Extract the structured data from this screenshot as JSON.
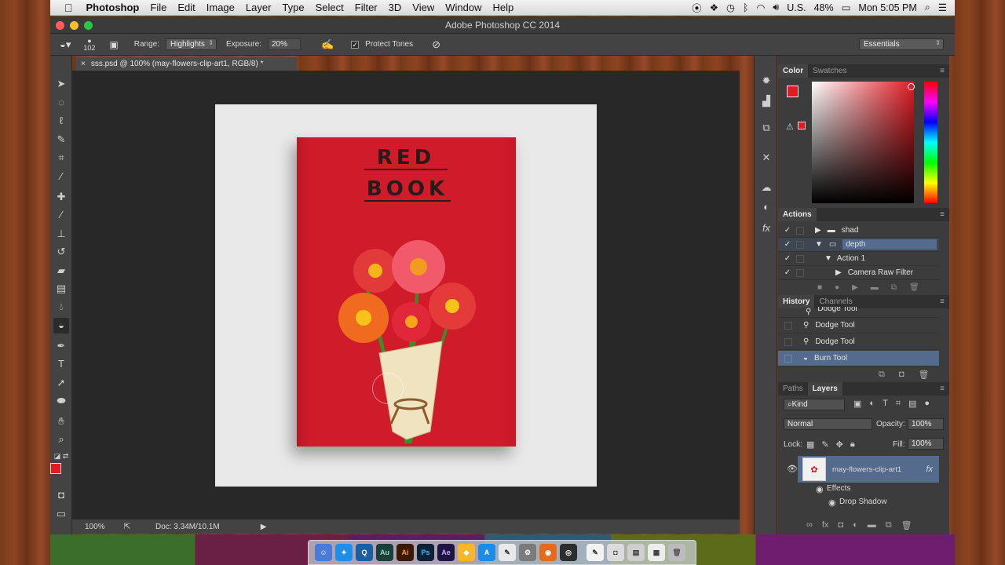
{
  "menubar": {
    "app": "Photoshop",
    "items": [
      "File",
      "Edit",
      "Image",
      "Layer",
      "Type",
      "Select",
      "Filter",
      "3D",
      "View",
      "Window",
      "Help"
    ],
    "input_source": "U.S.",
    "battery": "48%",
    "clock": "Mon 5:05 PM"
  },
  "window": {
    "title": "Adobe Photoshop CC 2014"
  },
  "options": {
    "brush_size": "102",
    "range_label": "Range:",
    "range_value": "Highlights",
    "exposure_label": "Exposure:",
    "exposure_value": "20%",
    "protect_tones": "Protect Tones",
    "workspace": "Essentials"
  },
  "document": {
    "tab_title": "sss.psd @ 100% (may-flowers-clip-art1, RGB/8) *",
    "book_line1": "RED",
    "book_line2": "BOOK",
    "zoom": "100%",
    "doc_size": "Doc: 3.34M/10.1M"
  },
  "panels": {
    "color_tab": "Color",
    "swatches_tab": "Swatches",
    "actions_tab": "Actions",
    "actions": [
      {
        "label": "shad",
        "checked": true
      },
      {
        "label": "depth",
        "checked": true
      },
      {
        "label": "Action 1",
        "checked": true
      },
      {
        "label": "Camera Raw Filter",
        "checked": true
      }
    ],
    "history_tab": "History",
    "channels_tab": "Channels",
    "history": [
      "Dodge Tool",
      "Dodge Tool",
      "Dodge Tool",
      "Burn Tool"
    ],
    "paths_tab": "Paths",
    "layers_tab": "Layers",
    "kind": "Kind",
    "blend_mode": "Normal",
    "opacity_label": "Opacity:",
    "opacity": "100%",
    "lock_label": "Lock:",
    "fill_label": "Fill:",
    "fill": "100%",
    "layer_name": "may-flowers-clip-art1",
    "effects": "Effects",
    "drop_shadow": "Drop Shadow"
  },
  "colors": {
    "foreground": "#e01b24",
    "selection": "#546b8e"
  }
}
